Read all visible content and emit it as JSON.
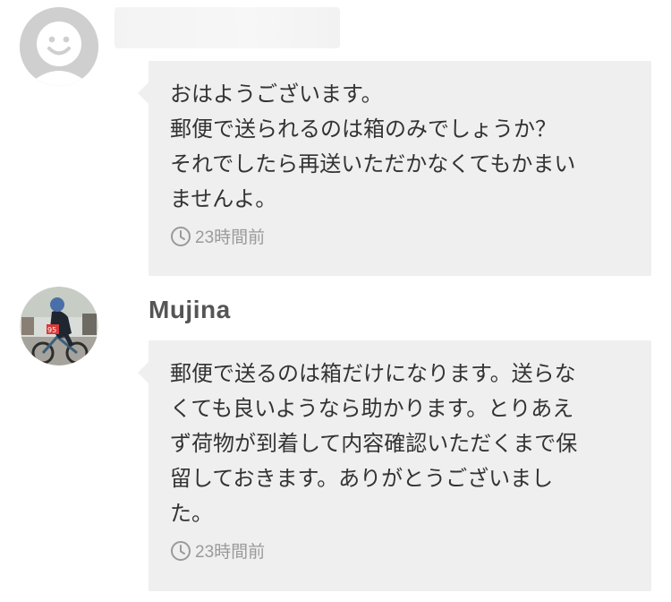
{
  "comments": [
    {
      "username": "",
      "text": "おはようございます。\n郵便で送られるのは箱のみでしょうか？\nそれでしたら再送いただかなくてもかまい\nませんよ。",
      "time": "23時間前",
      "avatar": "default-face-icon"
    },
    {
      "username": "Mujina",
      "text": "郵便で送るのは箱だけになります。送らな\nくても良いようなら助かります。とりあえ\nず荷物が到着して内容確認いただくまで保\n留しておきます。ありがとうございまし\nた。",
      "time": "23時間前",
      "avatar": "cyclist-photo",
      "avatar_bib": "95"
    }
  ],
  "colors": {
    "bubble": "#efefef",
    "meta": "#9a9a9a",
    "text": "#333333"
  }
}
